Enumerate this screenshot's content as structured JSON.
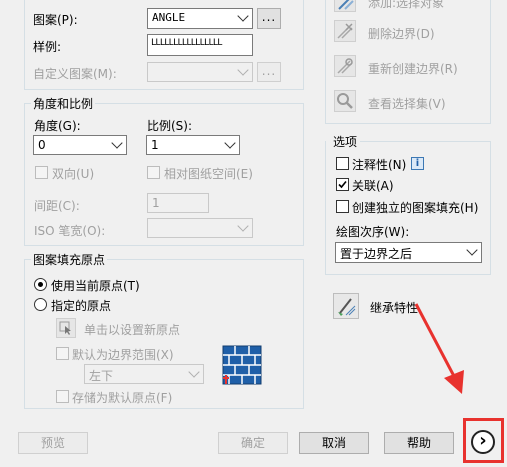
{
  "left": {
    "pattern": {
      "label": "图案(P):",
      "value": "ANGLE",
      "more": "..."
    },
    "swatch": {
      "label": "样例:",
      "sample": "LLLLLLLLLLLLLLLL"
    },
    "custom": {
      "label": "自定义图案(M):",
      "more": "..."
    },
    "angle_scale": {
      "title": "角度和比例",
      "angle_label": "角度(G):",
      "angle_value": "0",
      "scale_label": "比例(S):",
      "scale_value": "1",
      "double_label": "双向(U)",
      "relative_label": "相对图纸空间(E)",
      "spacing_label": "间距(C):",
      "spacing_value": "1",
      "iso_label": "ISO 笔宽(O):"
    },
    "origin": {
      "title": "图案填充原点",
      "use_current_label": "使用当前原点(T)",
      "specified_label": "指定的原点",
      "click_set_label": "单击以设置新原点",
      "default_extent_label": "默认为边界范围(X)",
      "position_value": "左下",
      "store_default_label": "存储为默认原点(F)"
    }
  },
  "right": {
    "boundary": {
      "add_select_label": "添加:选择对象",
      "remove_label": "删除边界(D)",
      "recreate_label": "重新创建边界(R)",
      "view_selection_label": "查看选择集(V)"
    },
    "options": {
      "title": "选项",
      "annotative_label": "注释性(N)",
      "info_glyph": "i",
      "associative_label": "关联(A)",
      "independent_label": "创建独立的图案填充(H)",
      "draw_order_label": "绘图次序(W):",
      "draw_order_value": "置于边界之后"
    },
    "inherit_label": "继承特性"
  },
  "footer": {
    "preview": "预览",
    "ok": "确定",
    "cancel": "取消",
    "help": "帮助",
    "more_glyph": "›"
  },
  "colors": {
    "annotation_red": "#e8322e",
    "group_border": "#d5dfe5",
    "dialog_bg": "#f0f0f0"
  }
}
